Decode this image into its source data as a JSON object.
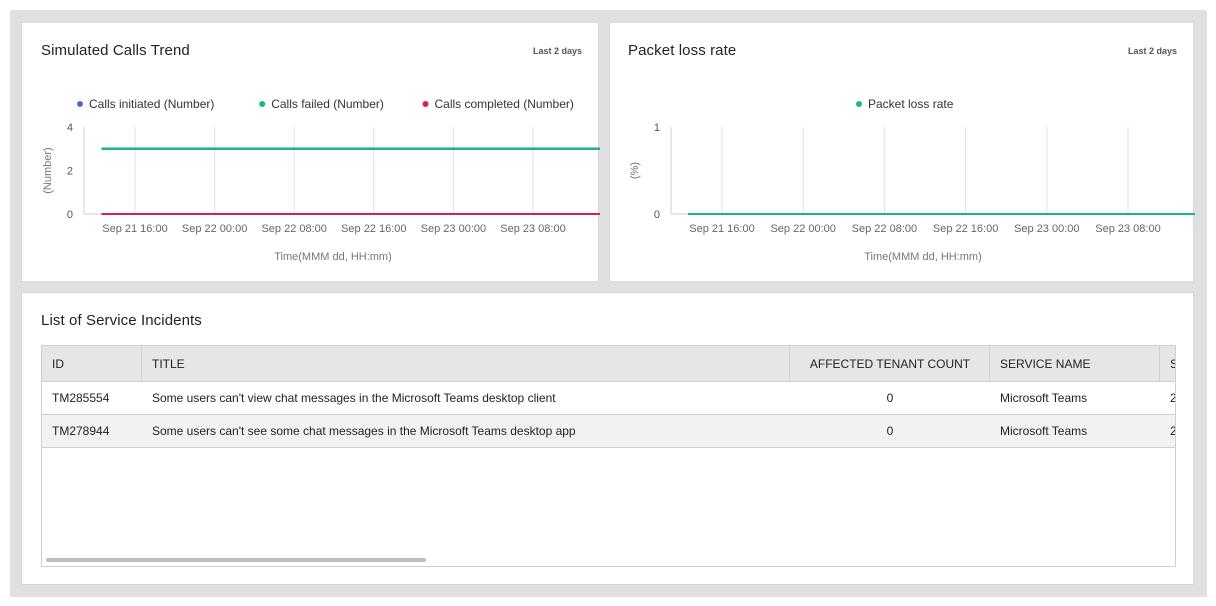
{
  "calls_panel": {
    "title": "Simulated Calls Trend",
    "range": "Last 2 days"
  },
  "packet_panel": {
    "title": "Packet loss rate",
    "range": "Last 2 days"
  },
  "incidents_panel": {
    "title": "List of Service Incidents",
    "columns": [
      "ID",
      "TITLE",
      "AFFECTED TENANT COUNT",
      "SERVICE NAME",
      "S"
    ],
    "rows": [
      {
        "id": "TM285554",
        "title": "Some users can't view chat messages in the Microsoft Teams desktop client",
        "count": "0",
        "service": "Microsoft Teams",
        "extra": "2"
      },
      {
        "id": "TM278944",
        "title": "Some users can't see some chat messages in the Microsoft Teams desktop app",
        "count": "0",
        "service": "Microsoft Teams",
        "extra": "2"
      }
    ]
  },
  "colors": {
    "initiated": "#4f6bbd",
    "failed": "#1db38a",
    "completed": "#e0195a"
  },
  "chart_data": [
    {
      "type": "line",
      "title": "Simulated Calls Trend",
      "subtitle": "Last 2 days",
      "xlabel": "Time(MMM dd, HH:mm)",
      "ylabel": "(Number)",
      "x_ticks": [
        "Sep 21 16:00",
        "Sep 22 00:00",
        "Sep 22 08:00",
        "Sep 22 16:00",
        "Sep 23 00:00",
        "Sep 23 08:00"
      ],
      "y_ticks": [
        "0",
        "2",
        "4"
      ],
      "ylim": [
        0,
        4
      ],
      "legend_position": "top-center",
      "series": [
        {
          "name": "Calls initiated (Number)",
          "color": "#4f6bbd",
          "values": [
            3,
            3
          ]
        },
        {
          "name": "Calls failed (Number)",
          "color": "#1db38a",
          "values": [
            3,
            3
          ]
        },
        {
          "name": "Calls completed (Number)",
          "color": "#e0195a",
          "values": [
            0,
            0
          ]
        }
      ],
      "x_start": 0.08,
      "x_end": 6.48
    },
    {
      "type": "line",
      "title": "Packet loss rate",
      "subtitle": "Last 2 days",
      "xlabel": "Time(MMM dd, HH:mm)",
      "ylabel": "(%)",
      "x_ticks": [
        "Sep 21 16:00",
        "Sep 22 00:00",
        "Sep 22 08:00",
        "Sep 22 16:00",
        "Sep 23 00:00",
        "Sep 23 08:00"
      ],
      "y_ticks": [
        "0",
        "1"
      ],
      "ylim": [
        0,
        1
      ],
      "legend_position": "top-center",
      "series": [
        {
          "name": "Packet loss rate",
          "color": "#1db38a",
          "values": [
            0,
            0
          ]
        }
      ],
      "x_start": 0.08,
      "x_end": 6.48
    }
  ]
}
